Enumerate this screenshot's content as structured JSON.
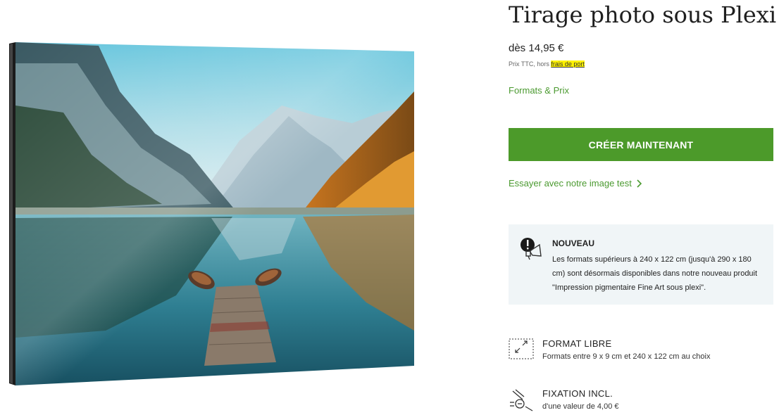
{
  "product": {
    "title": "Tirage photo sous Plexi",
    "price": "dès 14,95 €",
    "price_note_prefix": "Prix TTC, hors ",
    "price_note_link": "frais de port",
    "formats_link": "Formats & Prix",
    "cta_label": "CRÉER MAINTENANT",
    "test_link": "Essayer avec notre image test",
    "test_link_icon": "chevron-right-icon"
  },
  "news": {
    "icon": "megaphone-alert-icon",
    "title": "NOUVEAU",
    "text": "Les formats supérieurs à 240 x 122 cm (jusqu'à 290 x 180 cm) sont désormais disponibles dans notre nouveau produit \"Impression pigmentaire Fine Art sous plexi\"."
  },
  "features": [
    {
      "icon": "resize-frame-icon",
      "title": "FORMAT LIBRE",
      "subtitle": "Formats entre 9 x 9 cm et 240 x 122 cm au choix"
    },
    {
      "icon": "mounting-hardware-icon",
      "title": "FIXATION INCL.",
      "subtitle": "d'une valeur de 4,00 €"
    }
  ],
  "colors": {
    "accent_green": "#4c9a2a",
    "link_green": "#4b9a30",
    "news_background": "#f0f5f7",
    "highlight": "#fff200"
  }
}
